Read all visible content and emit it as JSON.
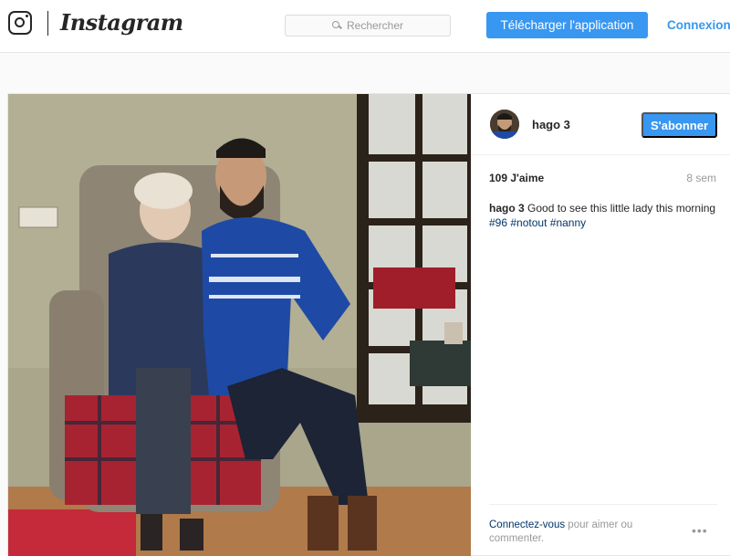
{
  "header": {
    "brand": "Instagram",
    "search_placeholder": "Rechercher",
    "download_label": "Télécharger l'application",
    "login_label": "Connexion"
  },
  "post": {
    "username": "hago_3",
    "username_display": "hago  3",
    "follow_label": "S'abonner",
    "likes": "109 J'aime",
    "time": "8 sem",
    "caption_user": "hago  3",
    "caption_text": " Good to see this little lady this morning ",
    "hashtags": [
      "#96",
      "#notout",
      "#nanny"
    ],
    "login_prompt_link": "Connectez-vous",
    "login_prompt_text": " pour aimer ou commenter.",
    "more_label": "•••"
  },
  "colors": {
    "accent": "#3897f0",
    "link": "#003569",
    "muted": "#999999"
  }
}
